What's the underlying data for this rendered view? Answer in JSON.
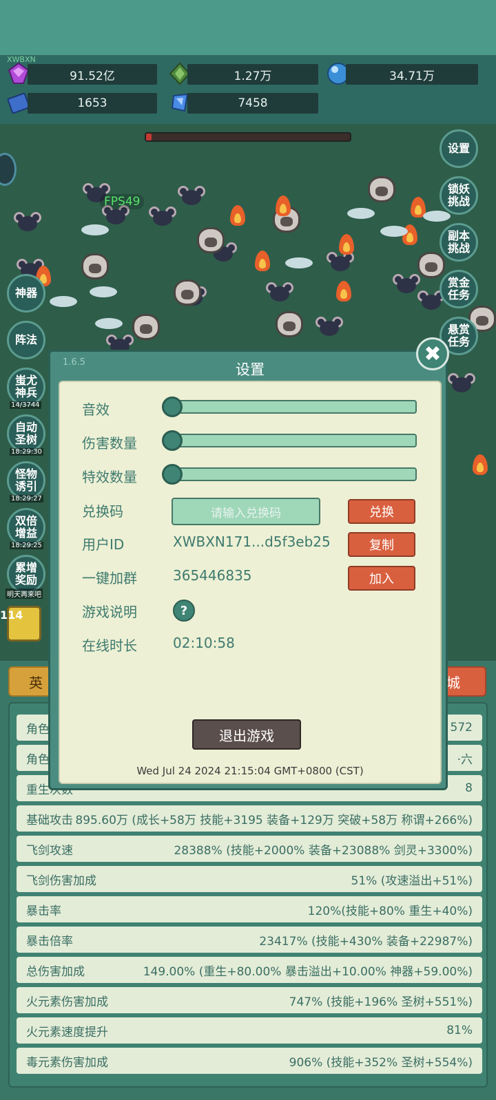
{
  "watermark": "XWBXN",
  "resources": [
    {
      "icon": "purple-gem-icon",
      "value": "91.52亿"
    },
    {
      "icon": "green-crystal-icon",
      "value": "1.27万"
    },
    {
      "icon": "blue-orb-icon",
      "value": "34.71万"
    },
    {
      "icon": "blue-book-icon",
      "value": "1653"
    },
    {
      "icon": "blue-shard-icon",
      "value": "7458"
    }
  ],
  "fps": "FPS49",
  "right_buttons": [
    "设置",
    "锁妖\n挑战",
    "副本\n挑战",
    "赏金\n任务",
    "悬赏\n任务"
  ],
  "left_buttons": [
    {
      "label": "神器",
      "time": ""
    },
    {
      "label": "阵法",
      "time": ""
    },
    {
      "label": "蚩尤\n神兵",
      "time": "14/3744"
    },
    {
      "label": "自动\n圣树",
      "time": "18:29:30"
    },
    {
      "label": "怪物\n诱引",
      "time": "18:29:27"
    },
    {
      "label": "双倍\n增益",
      "time": "18:29:25"
    },
    {
      "label": "累增\n奖励",
      "time": "明天再来吧"
    }
  ],
  "weapon_level": "114",
  "bottom": {
    "hero_tab": "英",
    "shop_tab": "城"
  },
  "stats": [
    {
      "label": "角色",
      "value": "572"
    },
    {
      "label": "角色",
      "value": "·六"
    },
    {
      "label": "重生次数",
      "value": "8"
    },
    {
      "label": "基础攻击",
      "value": "895.60万 (成长+58万 技能+3195 装备+129万 突破+58万 称谓+266%)"
    },
    {
      "label": "飞剑攻速",
      "value": "28388% (技能+2000% 装备+23088% 剑灵+3300%)"
    },
    {
      "label": "飞剑伤害加成",
      "value": "51% (攻速溢出+51%)"
    },
    {
      "label": "暴击率",
      "value": "120%(技能+80% 重生+40%)"
    },
    {
      "label": "暴击倍率",
      "value": "23417% (技能+430% 装备+22987%)"
    },
    {
      "label": "总伤害加成",
      "value": "149.00% (重生+80.00% 暴击溢出+10.00% 神器+59.00%)"
    },
    {
      "label": "火元素伤害加成",
      "value": "747% (技能+196% 圣树+551%)"
    },
    {
      "label": "火元素速度提升",
      "value": "81%"
    },
    {
      "label": "毒元素伤害加成",
      "value": "906% (技能+352% 圣树+554%)"
    }
  ],
  "dialog": {
    "version": "1.6.5",
    "title": "设置",
    "sound_label": "音效",
    "sound_level": 0,
    "damage_count_label": "伤害数量",
    "damage_count_level": 0,
    "effect_count_label": "特效数量",
    "effect_count_level": 0,
    "redeem_label": "兑换码",
    "redeem_placeholder": "请输入兑换码",
    "redeem_button": "兑换",
    "userid_label": "用户ID",
    "userid_value": "XWBXN171...d5f3eb25",
    "copy_button": "复制",
    "group_label": "一键加群",
    "group_value": "365446835",
    "join_button": "加入",
    "help_label": "游戏说明",
    "help_icon": "?",
    "online_label": "在线时长",
    "online_value": "02:10:58",
    "exit_button": "退出游戏",
    "datetime": "Wed Jul 24 2024 21:15:04 GMT+0800 (CST)",
    "close_icon": "✖"
  }
}
